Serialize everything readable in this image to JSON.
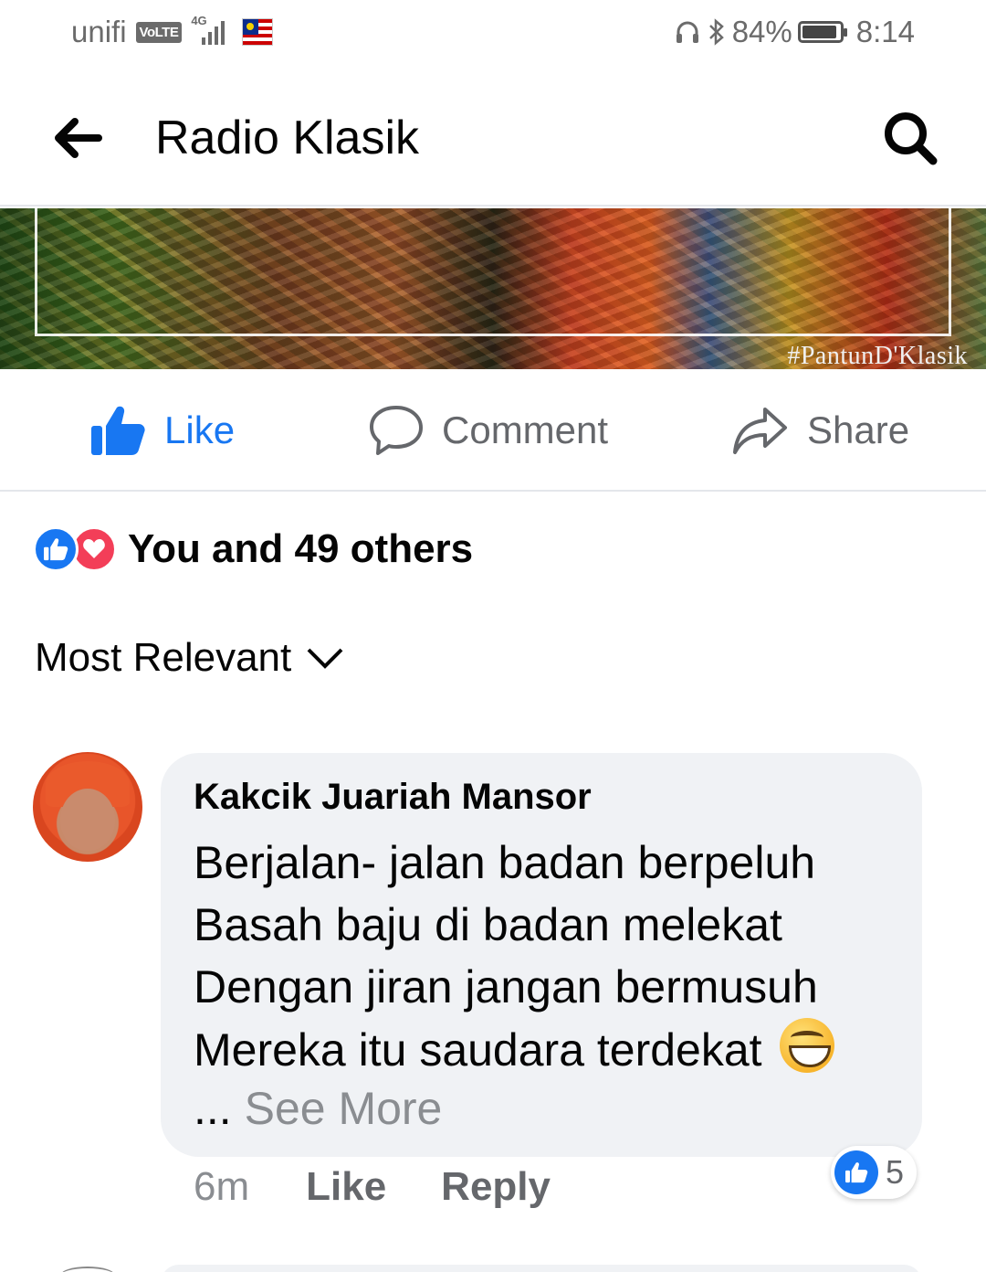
{
  "status_bar": {
    "carrier": "unifi",
    "volte": "VoLTE",
    "network": "4G",
    "signal_bars_of_4": 4,
    "battery_level": 0.84,
    "battery": "84%",
    "time": "8:14",
    "icons": [
      "headphones-icon",
      "bluetooth-icon",
      "malaysia-flag-icon"
    ]
  },
  "header": {
    "title": "Radio Klasik"
  },
  "banner": {
    "hashtag": "#PantunD'Klasik"
  },
  "actions": {
    "like": "Like",
    "comment": "Comment",
    "share": "Share",
    "like_color": "#1877f2"
  },
  "reactions": {
    "summary": "You and 49 others",
    "types": [
      "like",
      "love"
    ]
  },
  "sort": {
    "label": "Most Relevant"
  },
  "comment": {
    "author": "Kakcik Juariah Mansor",
    "lines": [
      "Berjalan- jalan badan berpeluh",
      "Basah baju di badan melekat",
      "Dengan jiran jangan bermusuh",
      "Mereka itu saudara terdekat"
    ],
    "ellipsis": "...",
    "see_more": "See More",
    "time": "6m",
    "like": "Like",
    "reply": "Reply",
    "reaction_count": "5"
  }
}
